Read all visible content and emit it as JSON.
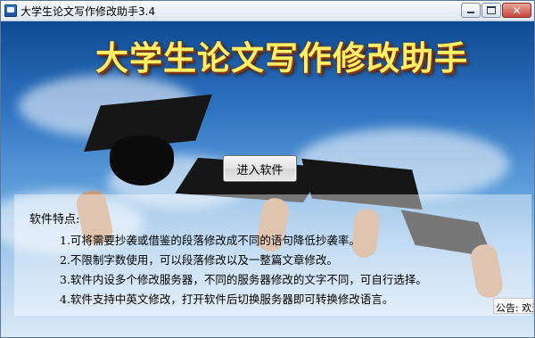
{
  "window": {
    "title": "大学生论文写作修改助手3.4",
    "controls": {
      "minimize_icon": "minimize-icon",
      "maximize_icon": "maximize-icon",
      "close_icon": "close-icon",
      "close_glyph": "✕"
    }
  },
  "banner": {
    "title": "大学生论文写作修改助手"
  },
  "enter_button": {
    "label": "进入软件"
  },
  "features": {
    "heading": "软件特点:",
    "items": [
      "1.可将需要抄袭或借鉴的段落修改成不同的语句降低抄袭率。",
      "2.不限制字数使用，可以段落修改以及一整篇文章修改。",
      "3.软件内设多个修改服务器，不同的服务器修改的文字不同，可自行选择。",
      "4.软件支持中英文修改，打开软件后切换服务器即可转换修改语言。"
    ]
  },
  "notice": {
    "text": "公告: 欢迎使"
  },
  "colors": {
    "title_yellow": "#fff066",
    "sky_top": "#0d4a93",
    "sky_bottom": "#dbe9f6"
  }
}
